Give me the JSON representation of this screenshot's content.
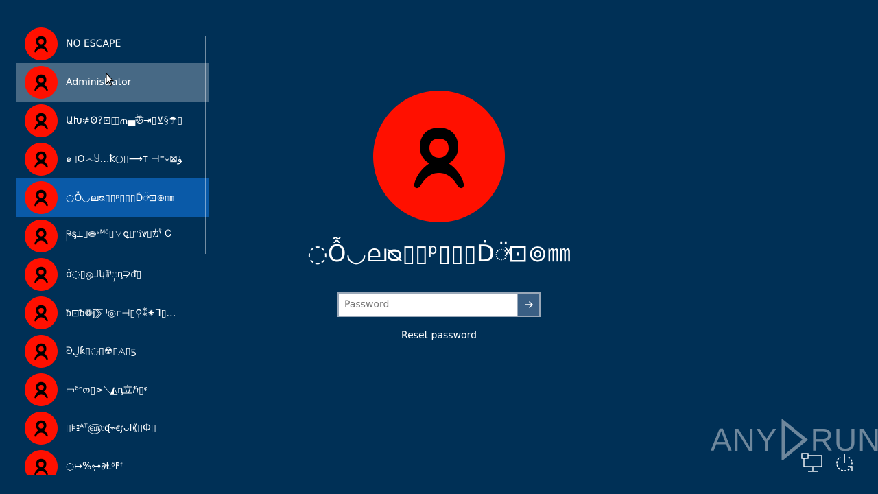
{
  "users": [
    {
      "name": "NO ESCAPE",
      "state": "normal"
    },
    {
      "name": "Administrator",
      "state": "hover"
    },
    {
      "name": "ԱԽ≉ʘ?⊡◫ጠ▄ঊ⇥▯⊻§☂▯",
      "state": "normal"
    },
    {
      "name": "๑▯ꓳ෴Ⴘ…ꝁ○▯⟶ᴛ ⊣⁼⁎⊠ﯜ",
      "state": "normal"
    },
    {
      "name": "◌Ỗ◡ലᴓ▯▯ᵖ▯▯▯Ḋ◌̈ͯ⊡⊚㎜",
      "state": "selected"
    },
    {
      "name": "ཥᶊ⟂▯⛂ˢᴹᵟ▯⌔ꝗ▯ᵔ⟟ꝟ▯が Ꮯ",
      "state": "normal"
    },
    {
      "name": "ở◌▯ஒ⅃ʮ⅌ှᶇ⊋ᵭ▯",
      "state": "normal"
    },
    {
      "name": "ᵬ⊡ᵬ❁ǰ⅀ᵸ◎ᴦ⊣▯♀⁑⁕ᒣ▯…",
      "state": "normal"
    },
    {
      "name": "ᘐڸƙ▯◌▯☢▯◬▯ƽ",
      "state": "normal"
    },
    {
      "name": "▭ᵟᵔო▯⋗⟍◭ᶇ立ℏ▯ᵠ",
      "state": "normal"
    },
    {
      "name": "▯⊧ᵻᴬᵀ௵ᶑ⌁ꞓᶉᴗꓲ⟪▯Ф▯",
      "state": "normal"
    },
    {
      "name": "◌↦%⊶ֽ∂Ɫᵟ𐌅ᶠ",
      "state": "normal"
    }
  ],
  "selected_user_name": "◌Ỗ◡ലᴓ▯▯ᵖ▯▯▯Ḋ◌̈ͯ⊡⊚㎜",
  "password": {
    "placeholder": "Password",
    "value": ""
  },
  "reset_password_label": "Reset password",
  "watermark": {
    "left": "ANY",
    "right": "RUN"
  },
  "icons": {
    "avatar": "user-silhouette-icon",
    "submit": "arrow-right-icon",
    "network": "network-icon",
    "power": "power-icon"
  },
  "colors": {
    "background": "#003056",
    "avatar": "#ff1000",
    "selected": "#0a5aa8",
    "submit_button": "#3a5f84"
  }
}
